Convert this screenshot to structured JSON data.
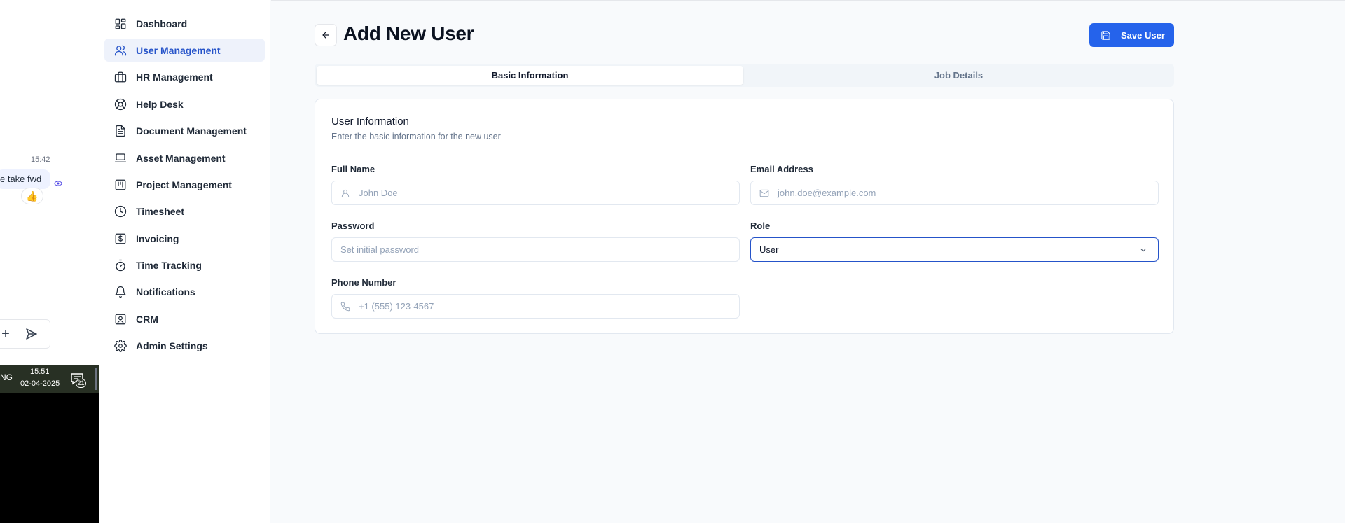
{
  "overlay": {
    "chat_time": "15:42",
    "chat_message": "e take fwd",
    "reaction": "👍",
    "taskbar_lang": "NG",
    "taskbar_time": "15:51",
    "taskbar_date": "02-04-2025",
    "taskbar_badge": "21"
  },
  "sidebar": {
    "items": [
      {
        "label": "Dashboard",
        "icon": "dashboard-icon"
      },
      {
        "label": "User Management",
        "icon": "users-icon",
        "active": true
      },
      {
        "label": "HR Management",
        "icon": "briefcase-icon"
      },
      {
        "label": "Help Desk",
        "icon": "lifebuoy-icon"
      },
      {
        "label": "Document Management",
        "icon": "file-text-icon"
      },
      {
        "label": "Asset Management",
        "icon": "laptop-icon"
      },
      {
        "label": "Project Management",
        "icon": "gantt-icon"
      },
      {
        "label": "Timesheet",
        "icon": "clock-icon"
      },
      {
        "label": "Invoicing",
        "icon": "dollar-receipt-icon"
      },
      {
        "label": "Time Tracking",
        "icon": "stopwatch-icon"
      },
      {
        "label": "Notifications",
        "icon": "bell-icon"
      },
      {
        "label": "CRM",
        "icon": "contact-card-icon"
      },
      {
        "label": "Admin Settings",
        "icon": "gear-icon"
      }
    ]
  },
  "header": {
    "title": "Add New User",
    "save_label": "Save User"
  },
  "tabs": [
    {
      "label": "Basic Information",
      "active": true
    },
    {
      "label": "Job Details",
      "active": false
    }
  ],
  "form": {
    "title": "User Information",
    "subtitle": "Enter the basic information for the new user",
    "full_name": {
      "label": "Full Name",
      "placeholder": "John Doe",
      "value": ""
    },
    "email": {
      "label": "Email Address",
      "placeholder": "john.doe@example.com",
      "value": ""
    },
    "password": {
      "label": "Password",
      "placeholder": "Set initial password",
      "value": ""
    },
    "role": {
      "label": "Role",
      "value": "User"
    },
    "phone": {
      "label": "Phone Number",
      "placeholder": "+1 (555) 123-4567",
      "value": ""
    }
  },
  "colors": {
    "accent": "#2563eb",
    "active_nav_bg": "#eef2fb",
    "active_nav_text": "#2553c9"
  }
}
